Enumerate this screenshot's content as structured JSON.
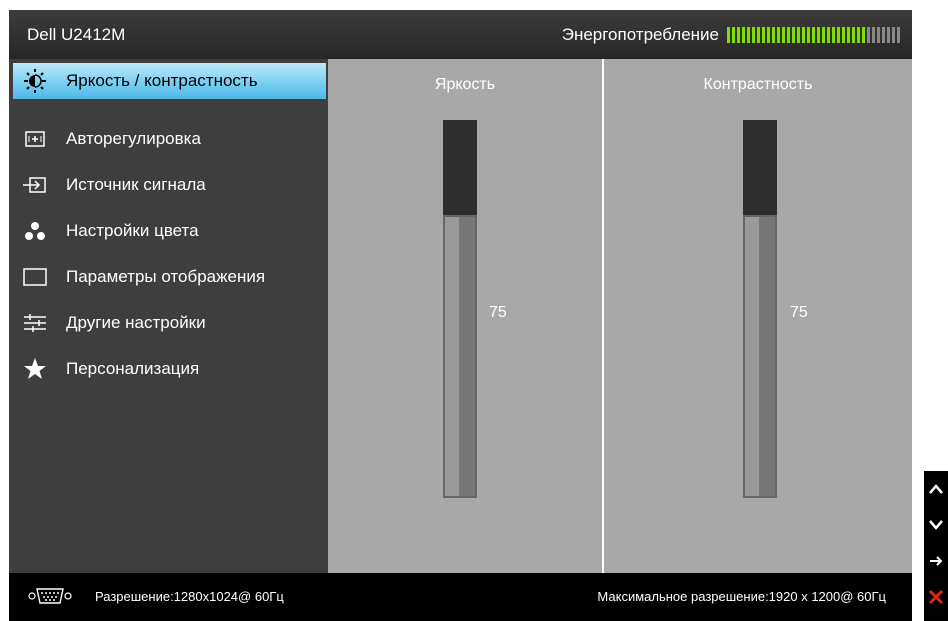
{
  "header": {
    "title": "Dell U2412M",
    "energy_label": "Энергопотребление",
    "energy_level": 0.8,
    "energy_on_color": "#7fe000",
    "energy_off_color": "#8a8a8a"
  },
  "menu": {
    "items": [
      {
        "label": "Яркость / контрастность",
        "icon": "brightness-icon",
        "selected": true
      },
      {
        "label": "Авторегулировка",
        "icon": "auto-adjust-icon"
      },
      {
        "label": "Источник сигнала",
        "icon": "input-source-icon"
      },
      {
        "label": "Настройки цвета",
        "icon": "color-settings-icon"
      },
      {
        "label": "Параметры отображения",
        "icon": "display-settings-icon"
      },
      {
        "label": "Другие настройки",
        "icon": "other-settings-icon"
      },
      {
        "label": "Персонализация",
        "icon": "star-icon"
      }
    ],
    "selected_color": "#79cff2"
  },
  "brightness": {
    "label": "Яркость",
    "value": "75",
    "level": 75
  },
  "contrast": {
    "label": "Контрастность",
    "value": "75",
    "level": 75
  },
  "footer": {
    "resolution": "Разрешение:1280x1024@ 60Гц",
    "max_resolution": "Максимальное разрешение:1920 x 1200@ 60Гц"
  },
  "buttons": [
    "up-arrow-icon",
    "down-arrow-icon",
    "right-arrow-icon",
    "close-icon"
  ]
}
